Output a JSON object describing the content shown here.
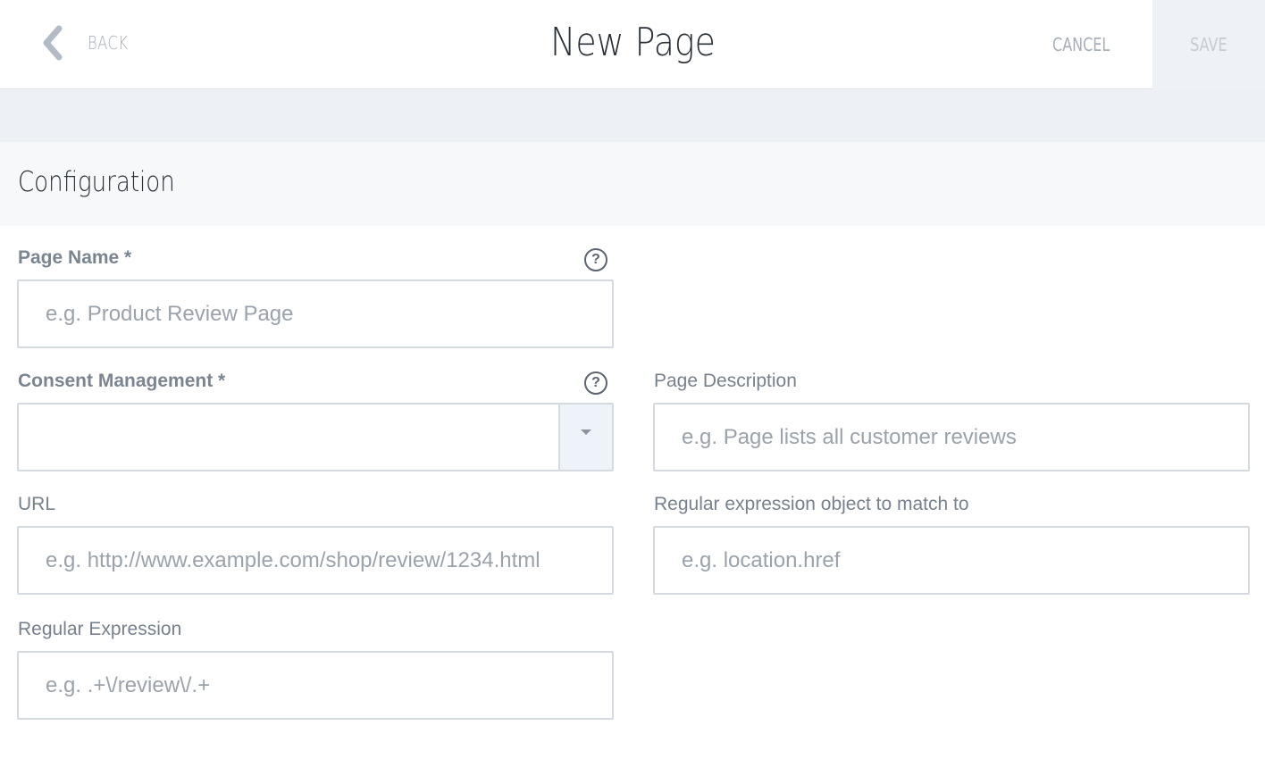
{
  "header": {
    "back_label": "BACK",
    "title": "New Page",
    "cancel_label": "CANCEL",
    "save_label": "SAVE"
  },
  "section": {
    "title": "Configuration"
  },
  "form": {
    "page_name": {
      "label": "Page Name *",
      "value": "",
      "placeholder": "e.g. Product Review Page",
      "help": "?"
    },
    "consent_management": {
      "label": "Consent Management *",
      "selected": "",
      "help": "?"
    },
    "page_description": {
      "label": "Page Description",
      "value": "",
      "placeholder": "e.g. Page lists all customer reviews"
    },
    "url": {
      "label": "URL",
      "value": "",
      "placeholder": "e.g. http://www.example.com/shop/review/1234.html"
    },
    "regex_object": {
      "label": "Regular expression object to match to",
      "value": "",
      "placeholder": "e.g. location.href"
    },
    "regular_expression": {
      "label": "Regular Expression",
      "value": "",
      "placeholder": "e.g. .+\\/review\\/.+"
    }
  },
  "colors": {
    "muted_text": "#a6afba",
    "label_text": "#77818d",
    "field_border": "#d5dae0",
    "band_bg": "#edf0f4",
    "save_bg": "#eef1f5"
  },
  "icons": {
    "back": "chevron-left-icon",
    "help": "question-circle-icon",
    "dropdown": "caret-down-icon"
  }
}
